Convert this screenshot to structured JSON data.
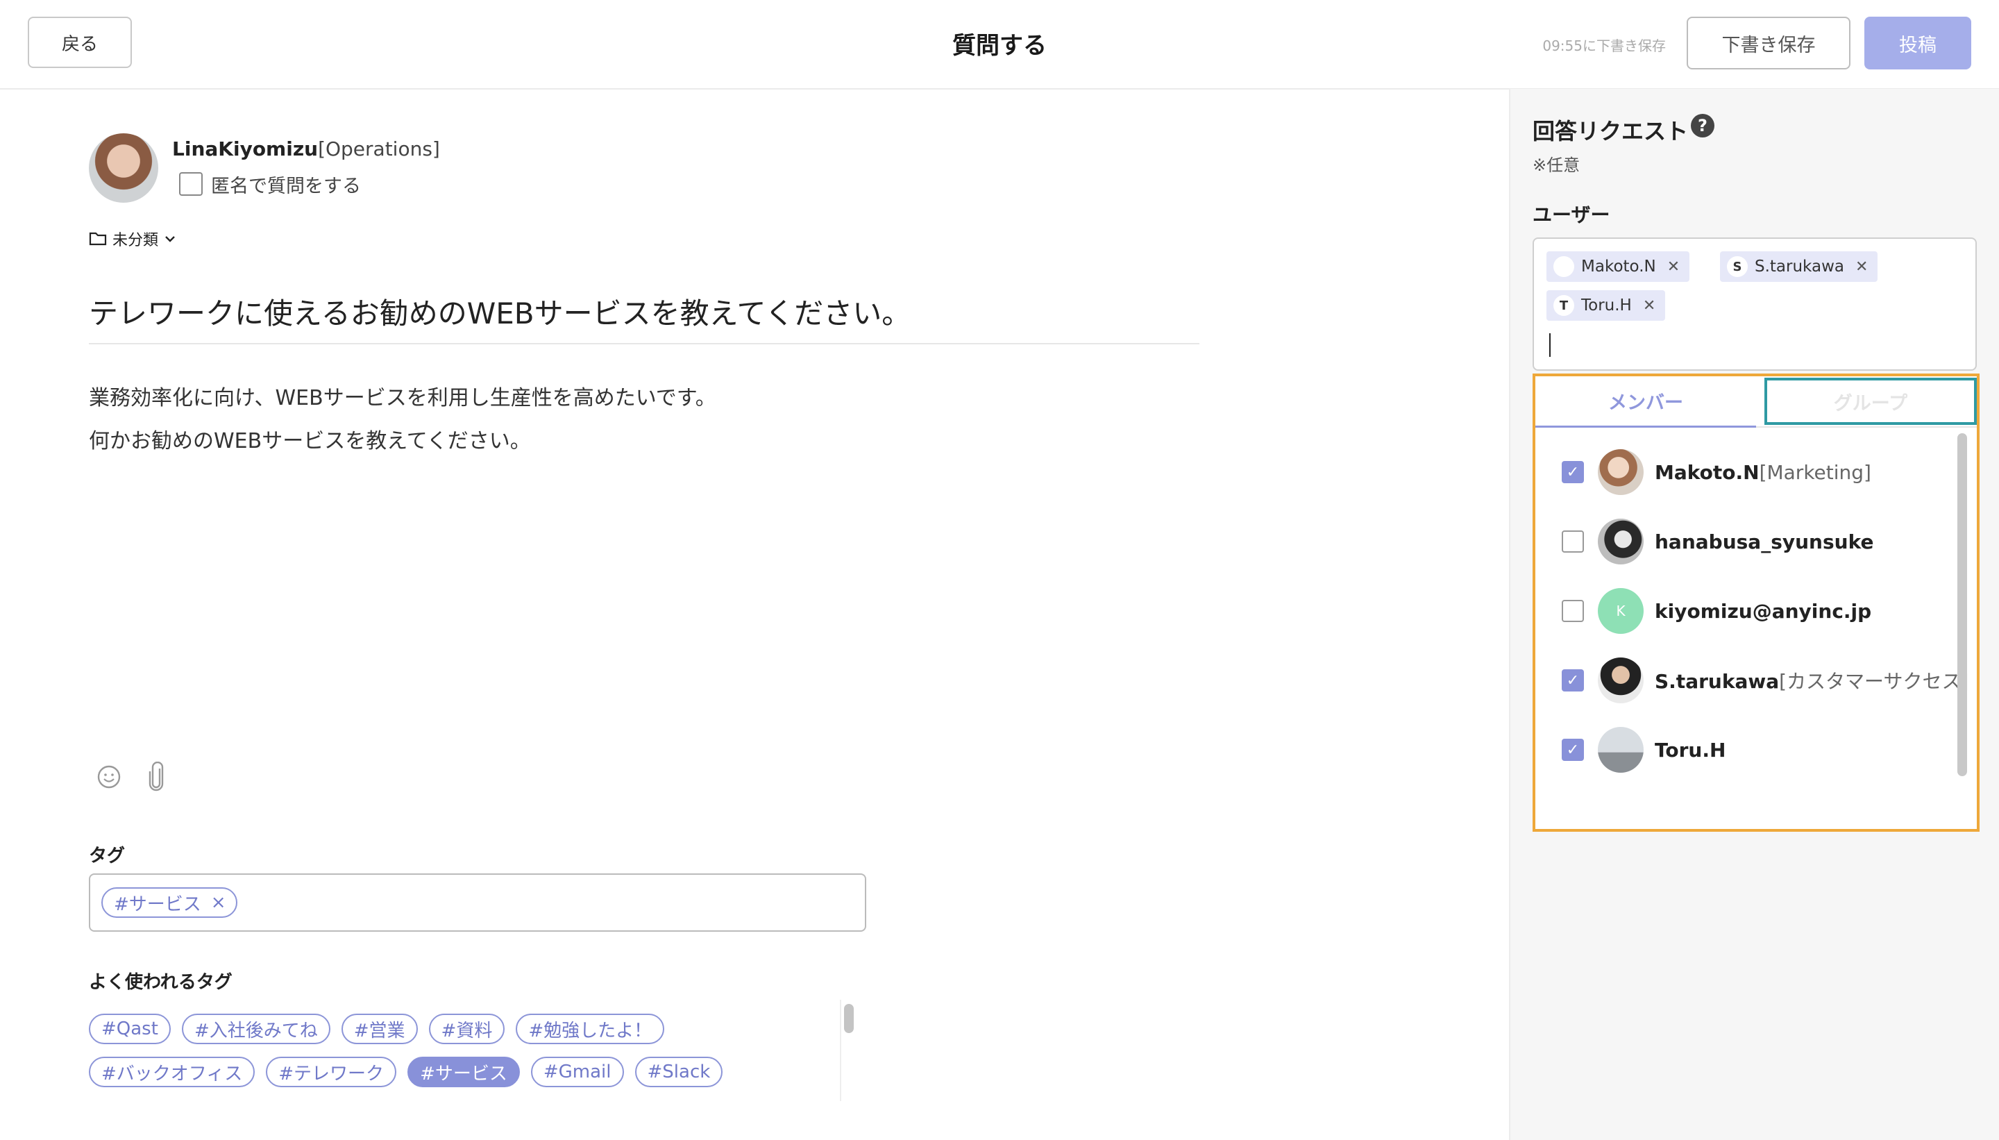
{
  "header": {
    "back_label": "戻る",
    "title": "質問する",
    "saved_status": "09:55に下書き保存",
    "draft_label": "下書き保存",
    "post_label": "投稿"
  },
  "author": {
    "name": "LinaKiyomizu",
    "dept": "[Operations]",
    "anonymous_label": "匿名で質問をする"
  },
  "category": {
    "label": "未分類"
  },
  "question": {
    "title": "テレワークに使えるお勧めのWEBサービスを教えてください。",
    "body_lines": [
      "業務効率化に向け、WEBサービスを利用し生産性を高めたいです。",
      "何かお勧めのWEBサービスを教えてください。"
    ]
  },
  "tags": {
    "label": "タグ",
    "selected": [
      "#サービス"
    ],
    "frequent_label": "よく使われるタグ",
    "frequent": [
      "#Qast",
      "#入社後みてね",
      "#営業",
      "#資料",
      "#勉強したよ！",
      "#バックオフィス",
      "#テレワーク",
      "#サービス",
      "#Gmail",
      "#Slack"
    ],
    "active_tag": "#サービス"
  },
  "answer_request": {
    "title": "回答リクエスト",
    "optional_note": "※任意",
    "users_label": "ユーザー",
    "selected_users": [
      {
        "name": "Makoto.N",
        "initial": ""
      },
      {
        "name": "S.tarukawa",
        "initial": "S"
      },
      {
        "name": "Toru.H",
        "initial": "T"
      }
    ],
    "tabs": {
      "member": "メンバー",
      "group": "グループ"
    },
    "members": [
      {
        "name": "Makoto.N",
        "dept": "[Marketing]",
        "checked": true
      },
      {
        "name": "hanabusa_syunsuke",
        "dept": "",
        "checked": false
      },
      {
        "name": "kiyomizu@anyinc.jp",
        "dept": "",
        "checked": false,
        "initial": "K"
      },
      {
        "name": "S.tarukawa",
        "dept": "[カスタマーサクセス]",
        "checked": true
      },
      {
        "name": "Toru.H",
        "dept": "",
        "checked": true
      }
    ]
  },
  "colors": {
    "accent": "#8891d9",
    "post_button": "#a5aeea",
    "dropdown_highlight": "#eea83a",
    "group_tab_highlight": "#2f9aa3"
  }
}
